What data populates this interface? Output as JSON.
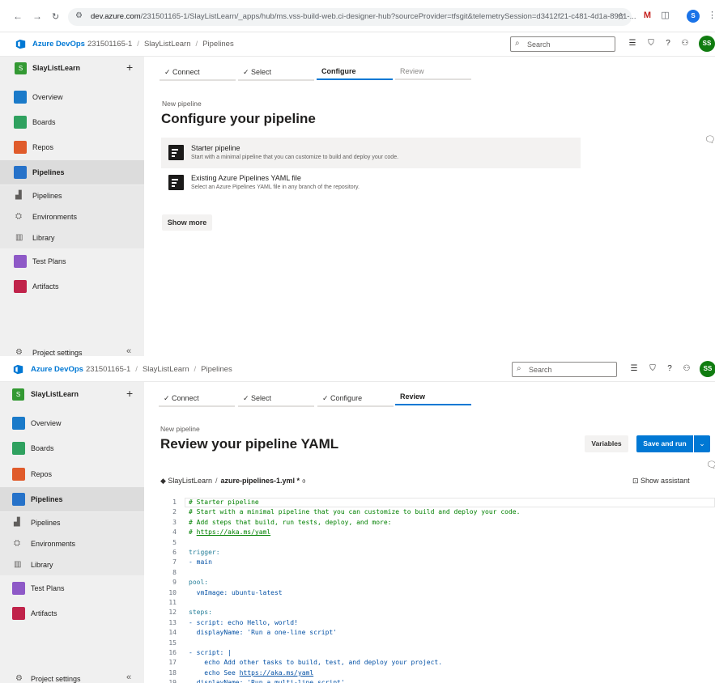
{
  "browser": {
    "url_host": "dev.azure.com",
    "url_rest": "/231501165-1/SlayListLearn/_apps/hub/ms.vss-build-web.ci-designer-hub?sourceProvider=tfsgit&telemetrySession=d3412f21-c481-4d1a-8981-...",
    "profile_initial": "S"
  },
  "header": {
    "brand": "Azure DevOps",
    "org": "231501165-1",
    "project": "SlayListLearn",
    "section": "Pipelines",
    "search_placeholder": "Search",
    "avatar_initials": "SS"
  },
  "sidebar": {
    "project_badge": "S",
    "project_name": "SlayListLearn",
    "items": {
      "overview": "Overview",
      "boards": "Boards",
      "repos": "Repos",
      "pipelines": "Pipelines",
      "pipelines_sub": "Pipelines",
      "environments": "Environments",
      "library": "Library",
      "test_plans": "Test Plans",
      "artifacts": "Artifacts"
    },
    "settings_label": "Project settings"
  },
  "wizard": {
    "connect": "Connect",
    "select": "Select",
    "configure": "Configure",
    "review": "Review"
  },
  "configure_page": {
    "subtitle": "New pipeline",
    "title": "Configure your pipeline",
    "options": [
      {
        "title": "Starter pipeline",
        "desc": "Start with a minimal pipeline that you can customize to build and deploy your code."
      },
      {
        "title": "Existing Azure Pipelines YAML file",
        "desc": "Select an Azure Pipelines YAML file in any branch of the repository."
      }
    ],
    "show_more": "Show more"
  },
  "review_page": {
    "subtitle": "New pipeline",
    "title": "Review your pipeline YAML",
    "variables_button": "Variables",
    "save_button": "Save and run",
    "repo": "SlayListLearn",
    "file": "azure-pipelines-1.yml *",
    "show_assistant": "Show assistant",
    "code": [
      {
        "n": "1",
        "t": "# Starter pipeline",
        "k": "comment"
      },
      {
        "n": "2",
        "t": "# Start with a minimal pipeline that you can customize to build and deploy your code.",
        "k": "comment"
      },
      {
        "n": "3",
        "t": "# Add steps that build, run tests, deploy, and more:",
        "k": "comment"
      },
      {
        "n": "4",
        "t": "# https://aka.ms/yaml",
        "k": "comment"
      },
      {
        "n": "5",
        "t": "",
        "k": "plain"
      },
      {
        "n": "6",
        "t": "trigger:",
        "k": "key"
      },
      {
        "n": "7",
        "t": "- main",
        "k": "plain"
      },
      {
        "n": "8",
        "t": "",
        "k": "plain"
      },
      {
        "n": "9",
        "t": "pool:",
        "k": "key"
      },
      {
        "n": "10",
        "t": "  vmImage: ubuntu-latest",
        "k": "plain"
      },
      {
        "n": "11",
        "t": "",
        "k": "plain"
      },
      {
        "n": "12",
        "t": "steps:",
        "k": "key"
      },
      {
        "n": "13",
        "t": "- script: echo Hello, world!",
        "k": "plain"
      },
      {
        "n": "14",
        "t": "  displayName: 'Run a one-line script'",
        "k": "plain"
      },
      {
        "n": "15",
        "t": "",
        "k": "plain"
      },
      {
        "n": "16",
        "t": "- script: |",
        "k": "plain"
      },
      {
        "n": "17",
        "t": "    echo Add other tasks to build, test, and deploy your project.",
        "k": "plain"
      },
      {
        "n": "18",
        "t": "    echo See https://aka.ms/yaml",
        "k": "plain"
      },
      {
        "n": "19",
        "t": "  displayName: 'Run a multi-line script'",
        "k": "plain"
      }
    ]
  }
}
